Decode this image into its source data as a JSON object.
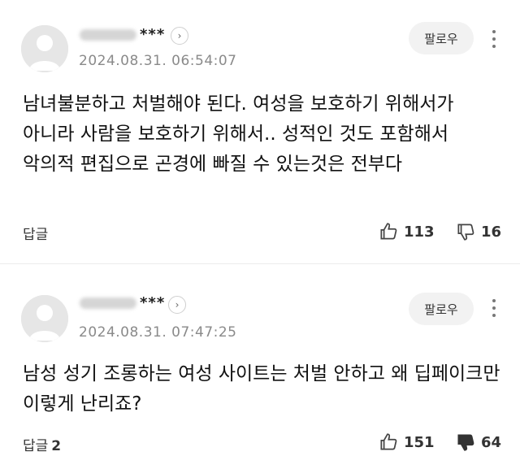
{
  "comments": [
    {
      "nickname_suffix": "***",
      "date": "2024.08.31. 06:54:07",
      "follow_label": "팔로우",
      "text": "남녀불분하고 처벌해야 된다. 여성을 보호하기 위해서가 아니라 사람을 보호하기 위해서.. 성적인 것도 포함해서 악의적 편집으로 곤경에 빠질 수 있는것은 전부다",
      "reply_label": "답글",
      "reply_count": "",
      "likes": "113",
      "dislikes": "16"
    },
    {
      "nickname_suffix": "***",
      "date": "2024.08.31. 07:47:25",
      "follow_label": "팔로우",
      "text": "남성 성기 조롱하는 여성 사이트는 처벌 안하고 왜 딥페이크만 이렇게 난리죠?",
      "reply_label": "답글",
      "reply_count": "2",
      "likes": "151",
      "dislikes": "64"
    }
  ],
  "icons": {
    "avatar": "default-user-avatar",
    "chevron": "chevron-right-icon",
    "more": "vertical-dots-icon",
    "like": "thumbs-up-icon",
    "dislike": "thumbs-down-icon"
  }
}
